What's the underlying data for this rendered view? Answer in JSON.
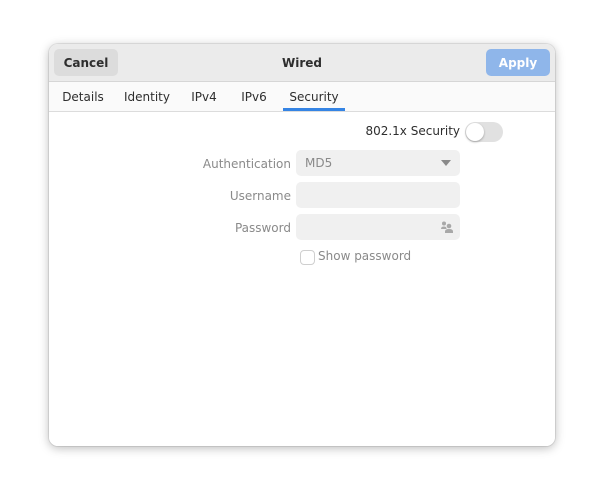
{
  "window": {
    "title": "Wired",
    "cancel_label": "Cancel",
    "apply_label": "Apply"
  },
  "tabs": [
    {
      "label": "Details",
      "active": false
    },
    {
      "label": "Identity",
      "active": false
    },
    {
      "label": "IPv4",
      "active": false
    },
    {
      "label": "IPv6",
      "active": false
    },
    {
      "label": "Security",
      "active": true
    }
  ],
  "security": {
    "toggle_label": "802.1x Security",
    "toggle_on": false,
    "authentication": {
      "label": "Authentication",
      "value": "MD5"
    },
    "username": {
      "label": "Username",
      "value": ""
    },
    "password": {
      "label": "Password",
      "value": "",
      "icon": "user-group-icon"
    },
    "show_password": {
      "label": "Show password",
      "checked": false
    }
  },
  "colors": {
    "accent": "#3584e4",
    "apply_button": "#8fb6ea"
  }
}
